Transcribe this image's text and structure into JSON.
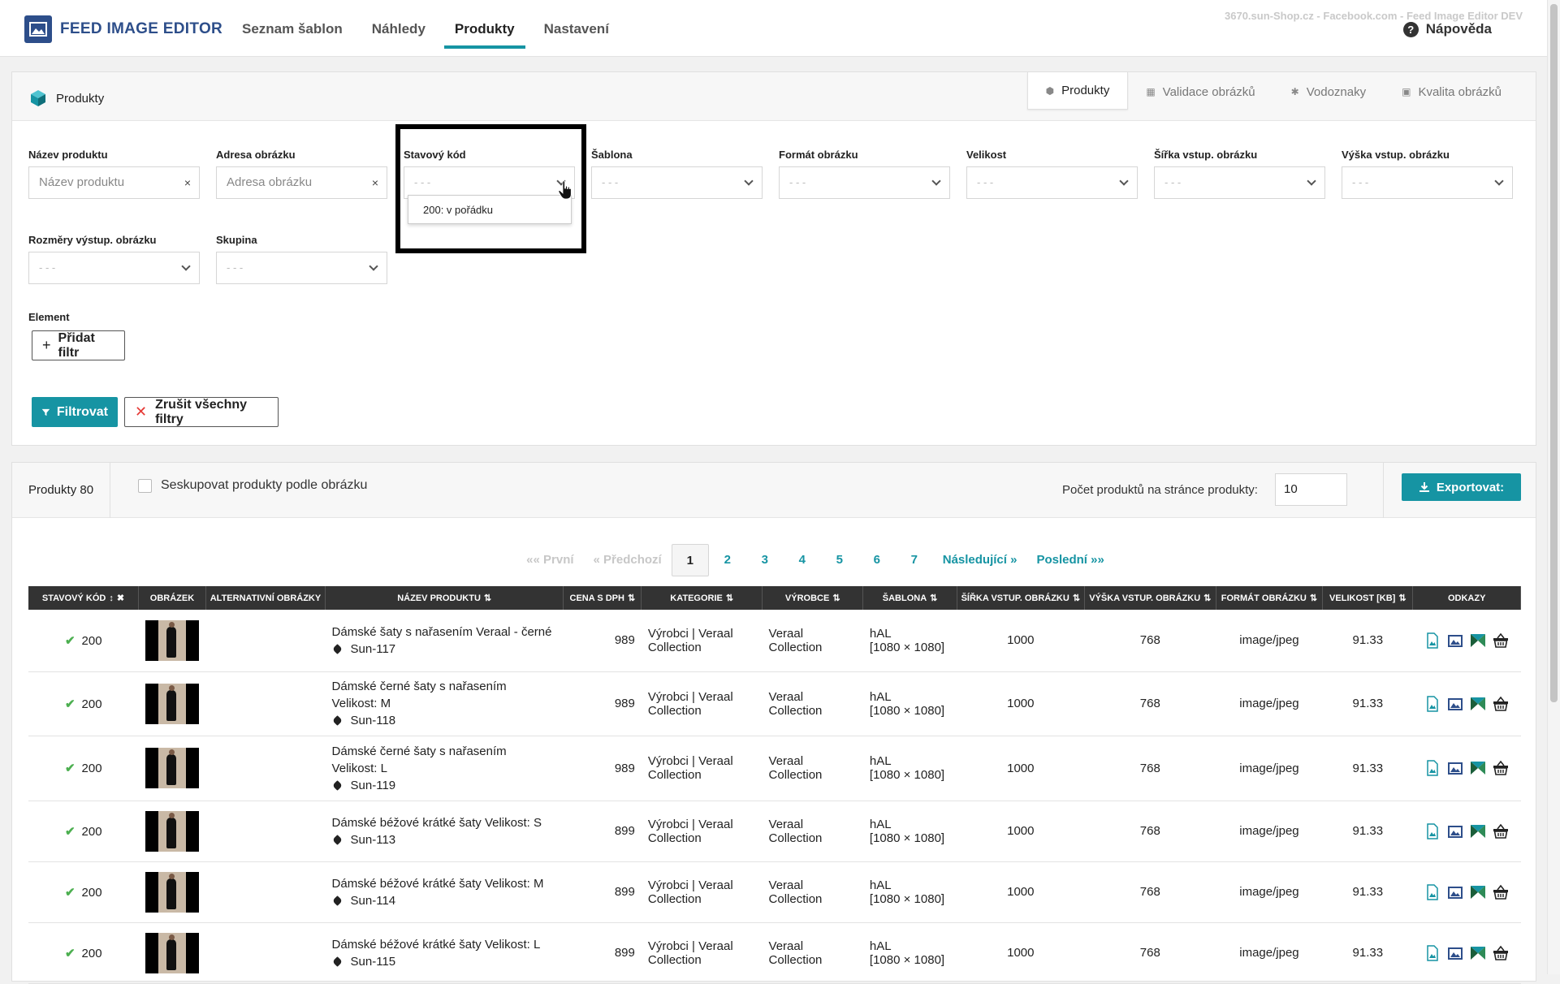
{
  "app": {
    "title": "FEED IMAGE EDITOR",
    "env_note": "3670.sun-Shop.cz - Facebook.com - Feed Image Editor DEV",
    "help_label": "Nápověda",
    "help_icon": "?"
  },
  "nav": {
    "items": [
      {
        "label": "Seznam šablon"
      },
      {
        "label": "Náhledy"
      },
      {
        "label": "Produkty",
        "active": true
      },
      {
        "label": "Nastavení"
      }
    ]
  },
  "filter_panel": {
    "title": "Produkty",
    "tabs": [
      {
        "label": "Produkty",
        "active": true
      },
      {
        "label": "Validace obrázků"
      },
      {
        "label": "Vodoznaky"
      },
      {
        "label": "Kvalita obrázků"
      }
    ],
    "fields": {
      "product_name": {
        "label": "Název produktu",
        "placeholder": "Název produktu",
        "clear": "×"
      },
      "image_url": {
        "label": "Adresa obrázku",
        "placeholder": "Adresa obrázku",
        "clear": "×"
      },
      "status_code": {
        "label": "Stavový kód",
        "value": "- - -"
      },
      "template": {
        "label": "Šablona",
        "value": "- - -"
      },
      "image_format": {
        "label": "Formát obrázku",
        "value": "- - -"
      },
      "size": {
        "label": "Velikost",
        "value": "- - -"
      },
      "input_width": {
        "label": "Šířka vstup. obrázku",
        "value": "- - -"
      },
      "input_height": {
        "label": "Výška vstup. obrázku",
        "value": "- - -"
      },
      "output_dims": {
        "label": "Rozměry výstup. obrázku",
        "value": "- - -"
      },
      "group": {
        "label": "Skupina",
        "value": "- - -"
      }
    },
    "status_dropdown_option": "200: v pořádku",
    "element_label": "Element",
    "add_filter": "Přidat filtr",
    "filter_button": "Filtrovat",
    "clear_button": "Zrušit všechny filtry"
  },
  "products_panel": {
    "count_label": "Produkty 80",
    "group_checkbox_label": "Seskupovat produkty podle obrázku",
    "per_page_label": "Počet produktů na stránce produkty:",
    "per_page_value": "10",
    "export_label": "Exportovat:",
    "pager": {
      "first": "«« První",
      "prev": "« Předchozí",
      "pages": [
        "1",
        "2",
        "3",
        "4",
        "5",
        "6",
        "7"
      ],
      "current": "1",
      "next": "Následující »",
      "last": "Poslední »»"
    },
    "columns": [
      "STAVOVÝ KÓD",
      "OBRÁZEK",
      "ALTERNATIVNÍ OBRÁZKY",
      "NÁZEV PRODUKTU",
      "CENA S DPH",
      "KATEGORIE",
      "VÝROBCE",
      "ŠABLONA",
      "ŠÍŘKA VSTUP. OBRÁZKU",
      "VÝŠKA VSTUP. OBRÁZKU",
      "FORMÁT OBRÁZKU",
      "VELIKOST [KB]",
      "ODKAZY"
    ],
    "rows": [
      {
        "status": "200",
        "name_lines": [
          "Dámské šaty s nařasením Veraal - černé"
        ],
        "sku": "Sun-117",
        "price": "989",
        "category": [
          "Výrobci | Veraal",
          "Collection"
        ],
        "maker": [
          "Veraal",
          "Collection"
        ],
        "template": [
          "hAL",
          "[1080 × 1080]"
        ],
        "in_w": "1000",
        "in_h": "768",
        "format": "image/jpeg",
        "size_kb": "91.33"
      },
      {
        "status": "200",
        "name_lines": [
          "Dámské černé šaty s nařasením",
          "Velikost: M"
        ],
        "sku": "Sun-118",
        "price": "989",
        "category": [
          "Výrobci | Veraal",
          "Collection"
        ],
        "maker": [
          "Veraal",
          "Collection"
        ],
        "template": [
          "hAL",
          "[1080 × 1080]"
        ],
        "in_w": "1000",
        "in_h": "768",
        "format": "image/jpeg",
        "size_kb": "91.33"
      },
      {
        "status": "200",
        "name_lines": [
          "Dámské černé šaty s nařasením",
          "Velikost: L"
        ],
        "sku": "Sun-119",
        "price": "989",
        "category": [
          "Výrobci | Veraal",
          "Collection"
        ],
        "maker": [
          "Veraal",
          "Collection"
        ],
        "template": [
          "hAL",
          "[1080 × 1080]"
        ],
        "in_w": "1000",
        "in_h": "768",
        "format": "image/jpeg",
        "size_kb": "91.33"
      },
      {
        "status": "200",
        "name_lines": [
          "Dámské béžové krátké šaty Velikost: S"
        ],
        "sku": "Sun-113",
        "price": "899",
        "category": [
          "Výrobci | Veraal",
          "Collection"
        ],
        "maker": [
          "Veraal",
          "Collection"
        ],
        "template": [
          "hAL",
          "[1080 × 1080]"
        ],
        "in_w": "1000",
        "in_h": "768",
        "format": "image/jpeg",
        "size_kb": "91.33"
      },
      {
        "status": "200",
        "name_lines": [
          "Dámské béžové krátké šaty Velikost: M"
        ],
        "sku": "Sun-114",
        "price": "899",
        "category": [
          "Výrobci | Veraal",
          "Collection"
        ],
        "maker": [
          "Veraal",
          "Collection"
        ],
        "template": [
          "hAL",
          "[1080 × 1080]"
        ],
        "in_w": "1000",
        "in_h": "768",
        "format": "image/jpeg",
        "size_kb": "91.33"
      },
      {
        "status": "200",
        "name_lines": [
          "Dámské béžové krátké šaty Velikost: L"
        ],
        "sku": "Sun-115",
        "price": "899",
        "category": [
          "Výrobci | Veraal",
          "Collection"
        ],
        "maker": [
          "Veraal",
          "Collection"
        ],
        "template": [
          "hAL",
          "[1080 × 1080]"
        ],
        "in_w": "1000",
        "in_h": "768",
        "format": "image/jpeg",
        "size_kb": "91.33"
      }
    ]
  },
  "colors": {
    "accent": "#1694a3",
    "brand": "#2d4e8a",
    "header_bg": "#333333",
    "ok_green": "#4caf50"
  }
}
